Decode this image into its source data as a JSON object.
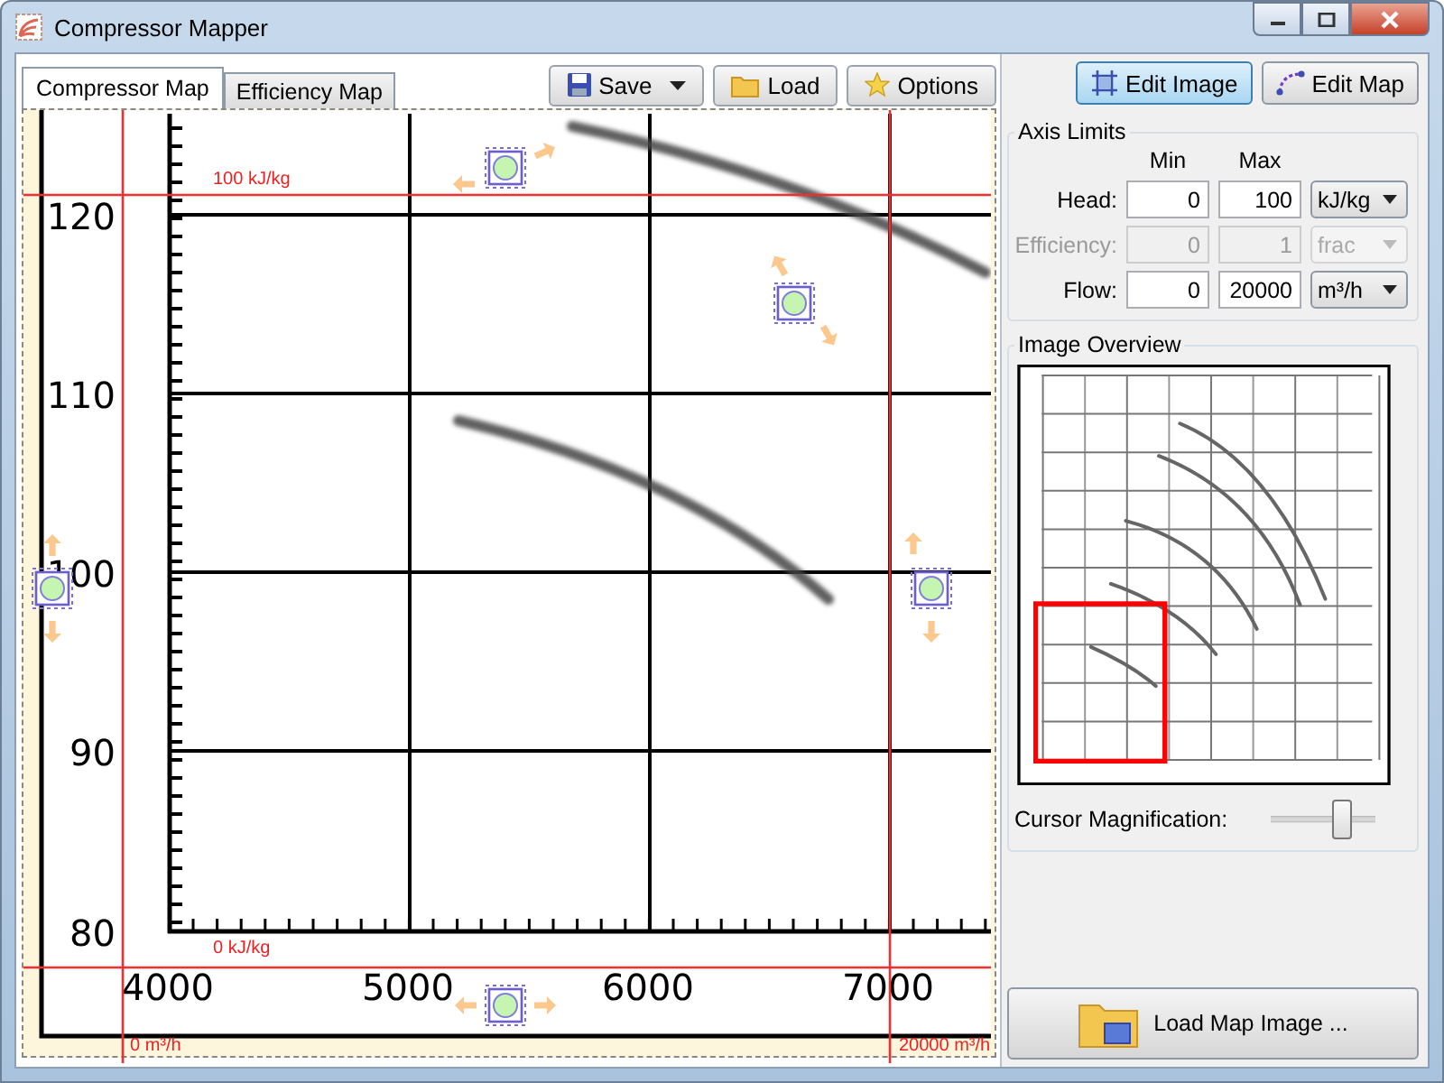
{
  "window": {
    "title": "Compressor Mapper"
  },
  "tabs": [
    {
      "label": "Compressor Map",
      "selected": true
    },
    {
      "label": "Efficiency Map",
      "selected": false
    }
  ],
  "toolbar": [
    {
      "label": "Save",
      "kind": "save",
      "dropdown": true
    },
    {
      "label": "Load",
      "kind": "load",
      "dropdown": false
    },
    {
      "label": "Options",
      "kind": "options",
      "dropdown": false
    }
  ],
  "modes": [
    {
      "label": "Edit Image",
      "kind": "image",
      "selected": true
    },
    {
      "label": "Edit Map",
      "kind": "map",
      "selected": false
    }
  ],
  "map_image": {
    "y_labels": [
      "120",
      "110",
      "100",
      "90",
      "80"
    ],
    "x_labels": [
      "4000",
      "5000",
      "6000",
      "7000"
    ]
  },
  "calibration_lines": [
    {
      "kind": "head_max",
      "label": "100 kJ/kg"
    },
    {
      "kind": "head_min",
      "label": "0 kJ/kg"
    },
    {
      "kind": "flow_min",
      "label": "0 m³/h"
    },
    {
      "kind": "flow_max",
      "label": "20000 m³/h"
    }
  ],
  "axis_limits": {
    "title": "Axis Limits",
    "min_header": "Min",
    "max_header": "Max",
    "rows": [
      {
        "label": "Head:",
        "min": "0",
        "max": "100",
        "unit": "kJ/kg",
        "disabled": false
      },
      {
        "label": "Efficiency:",
        "min": "0",
        "max": "1",
        "unit": "frac",
        "disabled": true
      },
      {
        "label": "Flow:",
        "min": "0",
        "max": "20000",
        "unit": "m³/h",
        "disabled": false
      }
    ]
  },
  "image_overview": {
    "title": "Image Overview"
  },
  "cursor_magnification": {
    "label": "Cursor Magnification:",
    "level": 0.68
  },
  "load_button": {
    "label": "Load Map Image ..."
  }
}
